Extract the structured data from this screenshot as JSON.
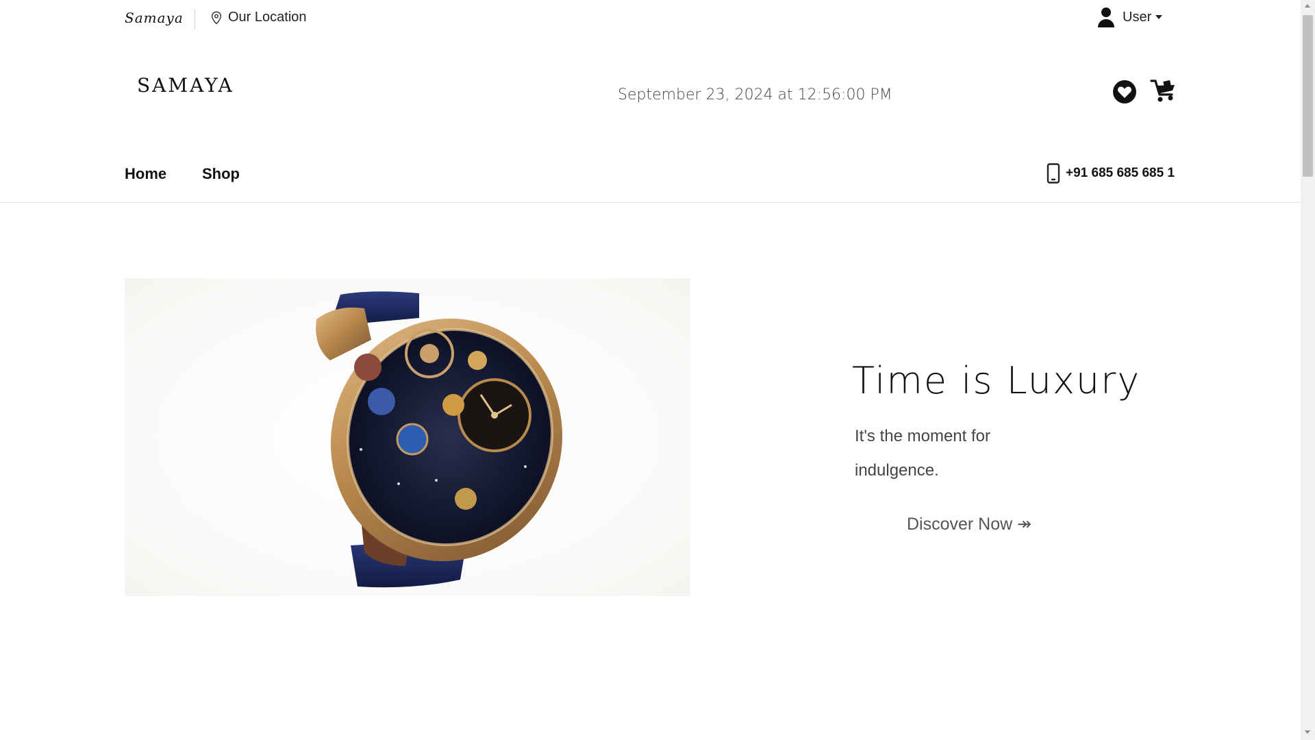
{
  "topbar": {
    "brand_script": "Samaya",
    "location_label": "Our Location",
    "location_icon": "map-pin-icon",
    "user_label": "User",
    "user_icon": "person-icon"
  },
  "header": {
    "logo": "SAMAYA",
    "datetime": "September 23, 2024 at 12:56:00 PM",
    "wishlist_icon": "heart-icon",
    "cart_icon": "cart-icon"
  },
  "nav": {
    "items": [
      {
        "label": "Home"
      },
      {
        "label": "Shop"
      }
    ],
    "phone": "+91 685 685 685 1",
    "phone_icon": "mobile-phone-icon"
  },
  "hero": {
    "image_alt": "luxury-watch-image",
    "title": "Time is Luxury",
    "subtitle": "It's the moment for indulgence.",
    "cta_label": "Discover Now ↠"
  },
  "colors": {
    "accent_gold": "#b98a4e",
    "strap_blue": "#1d2a5c",
    "text_dark": "#111111"
  }
}
